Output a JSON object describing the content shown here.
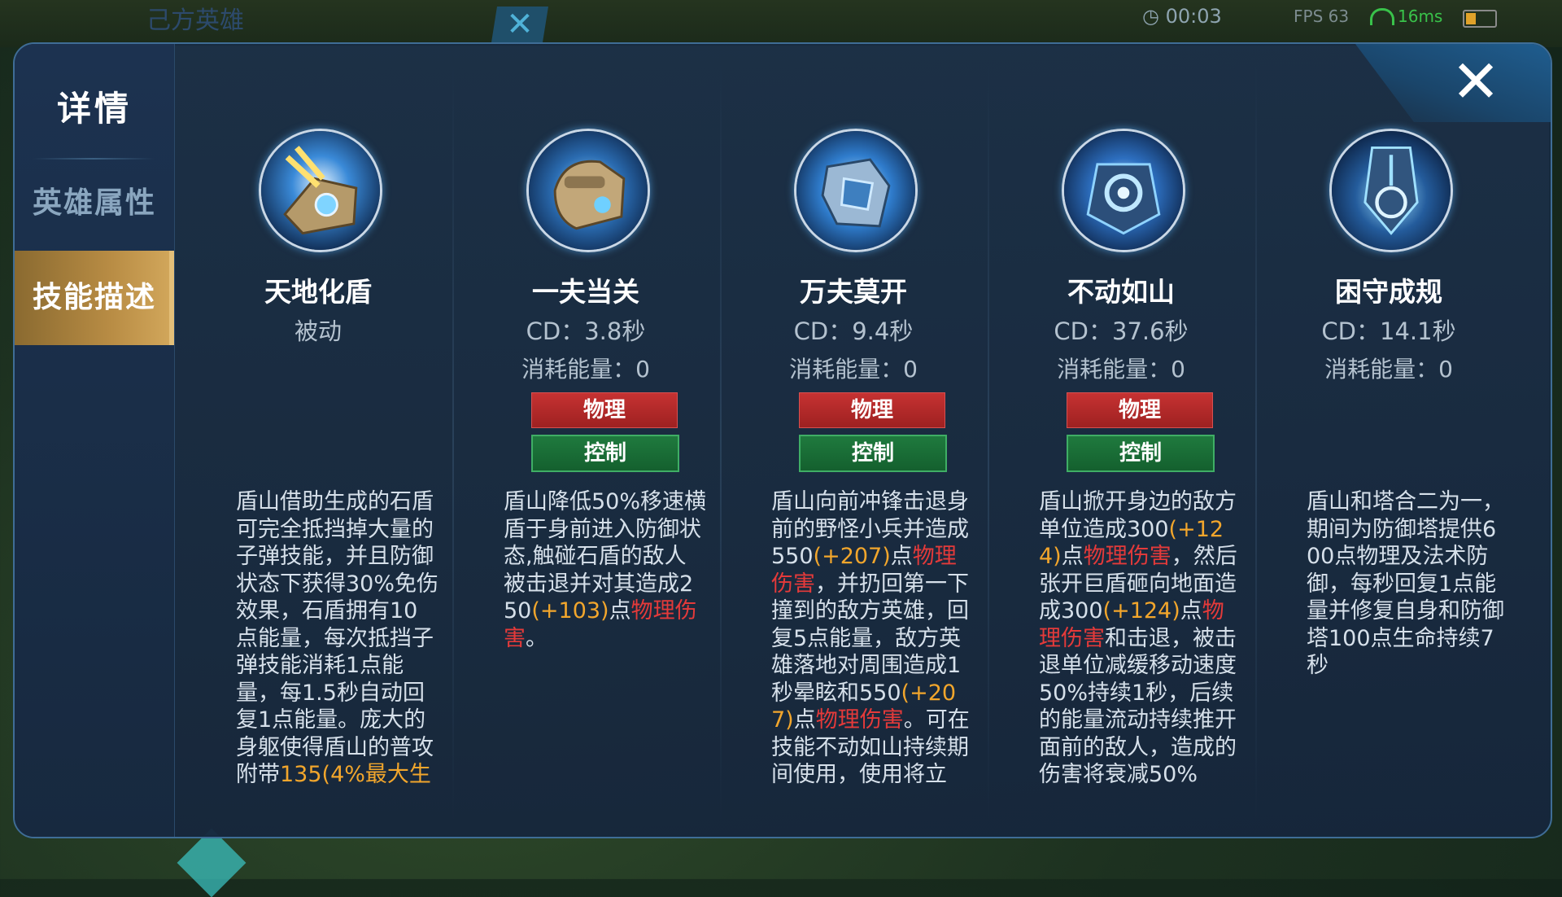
{
  "status_bar": {
    "team_label": "己方英雄",
    "timer": "00:03",
    "fps": "FPS 63",
    "ping": "16ms"
  },
  "sidebar": {
    "title": "详情",
    "items": [
      {
        "label": "英雄属性",
        "active": false
      },
      {
        "label": "技能描述",
        "active": true
      }
    ]
  },
  "close_label": "✕",
  "colors": {
    "accent_gold": "#b88c44",
    "tag_physical": "#c63232",
    "tag_control": "#1f7a3e",
    "highlight_orange": "#f2a62c",
    "highlight_red": "#e43a3a"
  },
  "skills": [
    {
      "name": "天地化盾",
      "subtitle": "被动",
      "cost": "",
      "tags": [],
      "description": [
        {
          "t": "盾山借助生成的石盾可完全抵挡掉大量的子弹技能，并且防御状态下获得30%免伤效果，石盾拥有10点能量，每次抵挡子弹技能消耗1点能量，每1.5秒自动回复1点能量。庞大的身躯使得盾山的普攻附带",
          "s": ""
        },
        {
          "t": "135(4%最大生",
          "s": "h"
        }
      ],
      "icon": "shield-gauntlet-icon"
    },
    {
      "name": "一夫当关",
      "subtitle": "CD：3.8秒",
      "cost": "消耗能量：0",
      "tags": [
        "物理",
        "控制"
      ],
      "description": [
        {
          "t": "盾山降低50%移速横盾于身前进入防御状态,触碰石盾的敌人被击退并对其造成250",
          "s": ""
        },
        {
          "t": "(+103)",
          "s": "h"
        },
        {
          "t": "点",
          "s": ""
        },
        {
          "t": "物理伤害",
          "s": "r"
        },
        {
          "t": "。",
          "s": ""
        }
      ],
      "icon": "fist-shield-icon"
    },
    {
      "name": "万夫莫开",
      "subtitle": "CD：9.4秒",
      "cost": "消耗能量：0",
      "tags": [
        "物理",
        "控制"
      ],
      "description": [
        {
          "t": "盾山向前冲锋击退身前的野怪小兵并造成550",
          "s": ""
        },
        {
          "t": "(+207)",
          "s": "h"
        },
        {
          "t": "点",
          "s": ""
        },
        {
          "t": "物理伤害",
          "s": "r"
        },
        {
          "t": "，并扔回第一下撞到的敌方英雄，回复5点能量，敌方英雄落地对周围造成1秒晕眩和550",
          "s": ""
        },
        {
          "t": "(+207)",
          "s": "h"
        },
        {
          "t": "点",
          "s": ""
        },
        {
          "t": "物理伤害",
          "s": "r"
        },
        {
          "t": "。可在技能不动如山持续期间使用，使用将立",
          "s": ""
        }
      ],
      "icon": "charge-icon"
    },
    {
      "name": "不动如山",
      "subtitle": "CD：37.6秒",
      "cost": "消耗能量：0",
      "tags": [
        "物理",
        "控制"
      ],
      "description": [
        {
          "t": "盾山掀开身边的敌方单位造成300",
          "s": ""
        },
        {
          "t": "(+124)",
          "s": "h"
        },
        {
          "t": "点",
          "s": ""
        },
        {
          "t": "物理伤害",
          "s": "r"
        },
        {
          "t": "，然后张开巨盾砸向地面造成300",
          "s": ""
        },
        {
          "t": "(+124)",
          "s": "h"
        },
        {
          "t": "点",
          "s": ""
        },
        {
          "t": "物理伤害",
          "s": "r"
        },
        {
          "t": "和击退，被击退单位减缓移动速度50%持续1秒，后续的能量流动持续推开面前的敌人，造成的伤害将衰减50%",
          "s": ""
        }
      ],
      "icon": "great-shield-icon"
    },
    {
      "name": "困守成规",
      "subtitle": "CD：14.1秒",
      "cost": "消耗能量：0",
      "tags": [],
      "description": [
        {
          "t": "盾山和塔合二为一，期间为防御塔提供600点物理及法术防御，每秒回复1点能量并修复自身和防御塔100点生命持续7秒",
          "s": ""
        }
      ],
      "icon": "tower-merge-icon"
    }
  ]
}
